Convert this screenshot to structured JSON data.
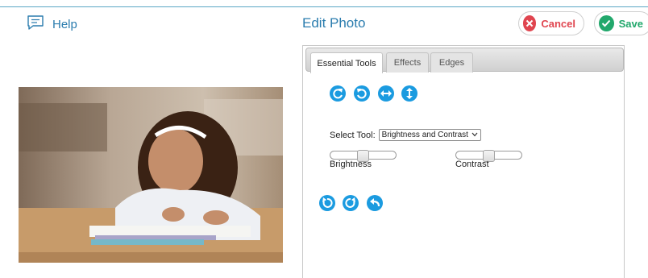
{
  "header": {
    "help_label": "Help",
    "title": "Edit Photo",
    "cancel_label": "Cancel",
    "save_label": "Save"
  },
  "colors": {
    "accent": "#2a7cae",
    "cancel": "#e0454f",
    "save": "#22a86c",
    "tool_icon": "#1b9be0"
  },
  "tabs": [
    {
      "label": "Essential Tools",
      "active": true
    },
    {
      "label": "Effects",
      "active": false
    },
    {
      "label": "Edges",
      "active": false
    }
  ],
  "toolbar_top": {
    "icons": [
      "rotate-left-icon",
      "rotate-right-icon",
      "flip-horizontal-icon",
      "flip-vertical-icon"
    ]
  },
  "select_tool": {
    "label": "Select Tool:",
    "value": "Brightness and Contrast"
  },
  "sliders": {
    "brightness": {
      "label": "Brightness",
      "level": 0.5
    },
    "contrast": {
      "label": "Contrast",
      "level": 0.5
    }
  },
  "toolbar_bottom": {
    "icons": [
      "undo-icon",
      "redo-icon",
      "reset-icon"
    ]
  }
}
